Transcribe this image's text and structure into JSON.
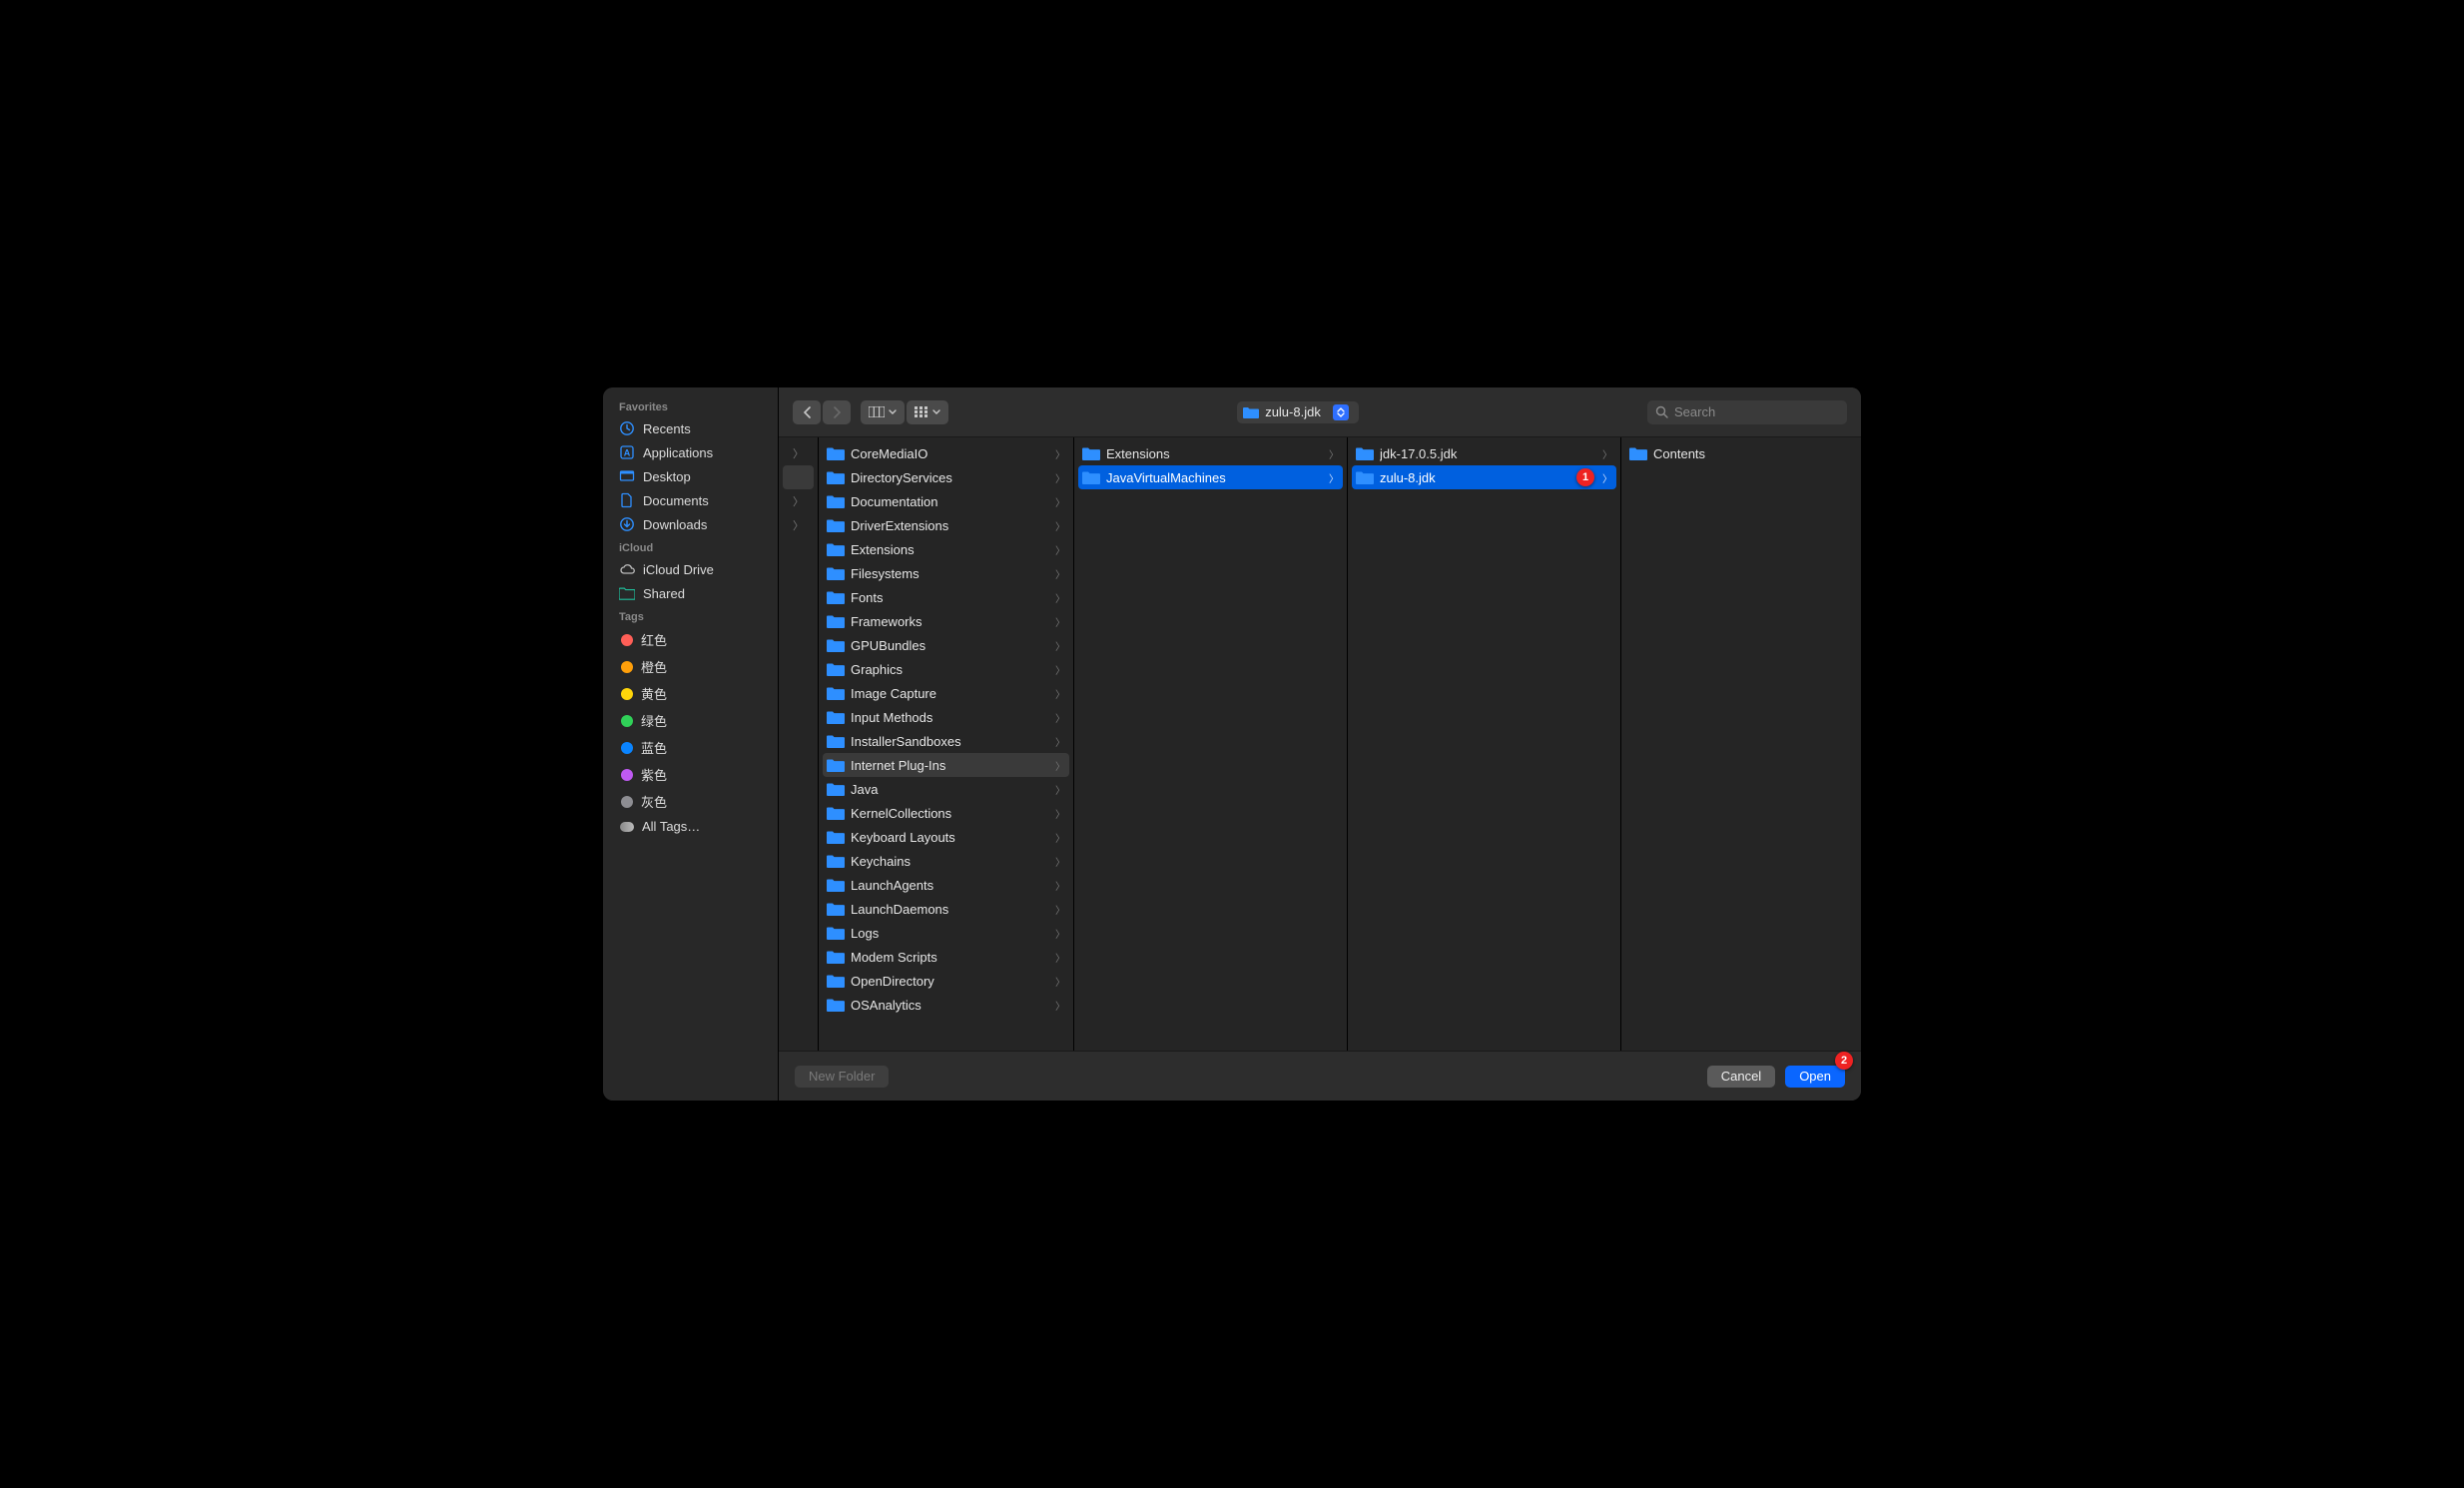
{
  "sidebar": {
    "sections": [
      {
        "header": "Favorites",
        "items": [
          {
            "icon": "clock",
            "label": "Recents"
          },
          {
            "icon": "grid",
            "label": "Applications"
          },
          {
            "icon": "desktop",
            "label": "Desktop",
            "showsChevron": true
          },
          {
            "icon": "doc",
            "label": "Documents"
          },
          {
            "icon": "download",
            "label": "Downloads"
          }
        ]
      },
      {
        "header": "iCloud",
        "items": [
          {
            "icon": "cloud",
            "label": "iCloud Drive"
          },
          {
            "icon": "shared",
            "label": "Shared"
          }
        ]
      },
      {
        "header": "Tags",
        "items": [
          {
            "icon": "dot",
            "color": "#ff5f57",
            "label": "红色"
          },
          {
            "icon": "dot",
            "color": "#ff9f0a",
            "label": "橙色"
          },
          {
            "icon": "dot",
            "color": "#ffd60a",
            "label": "黄色"
          },
          {
            "icon": "dot",
            "color": "#30d158",
            "label": "绿色"
          },
          {
            "icon": "dot",
            "color": "#0a84ff",
            "label": "蓝色"
          },
          {
            "icon": "dot",
            "color": "#bf5af2",
            "label": "紫色"
          },
          {
            "icon": "dot",
            "color": "#8e8e93",
            "label": "灰色"
          },
          {
            "icon": "alltags",
            "label": "All Tags…"
          }
        ]
      }
    ]
  },
  "toolbar": {
    "pathTitle": "zulu-8.jdk",
    "searchPlaceholder": "Search"
  },
  "columns": {
    "c0": {
      "rows": [
        {
          "hasChevron": true
        },
        {
          "hasChevron": false,
          "selected": true
        },
        {
          "hasChevron": true
        },
        {
          "hasChevron": true
        }
      ]
    },
    "c1": {
      "selectedIndex": 13,
      "items": [
        "CoreMediaIO",
        "DirectoryServices",
        "Documentation",
        "DriverExtensions",
        "Extensions",
        "Filesystems",
        "Fonts",
        "Frameworks",
        "GPUBundles",
        "Graphics",
        "Image Capture",
        "Input Methods",
        "InstallerSandboxes",
        "Internet Plug-Ins",
        "Java",
        "KernelCollections",
        "Keyboard Layouts",
        "Keychains",
        "LaunchAgents",
        "LaunchDaemons",
        "Logs",
        "Modem Scripts",
        "OpenDirectory",
        "OSAnalytics"
      ]
    },
    "c2": {
      "selectedIndex": 1,
      "items": [
        "Extensions",
        "JavaVirtualMachines"
      ]
    },
    "c3": {
      "selectedIndex": 1,
      "items": [
        "jdk-17.0.5.jdk",
        "zulu-8.jdk"
      ],
      "badge": "1"
    },
    "c4": {
      "items": [
        "Contents"
      ]
    }
  },
  "footer": {
    "newFolder": "New Folder",
    "cancel": "Cancel",
    "open": "Open",
    "openBadge": "2"
  }
}
